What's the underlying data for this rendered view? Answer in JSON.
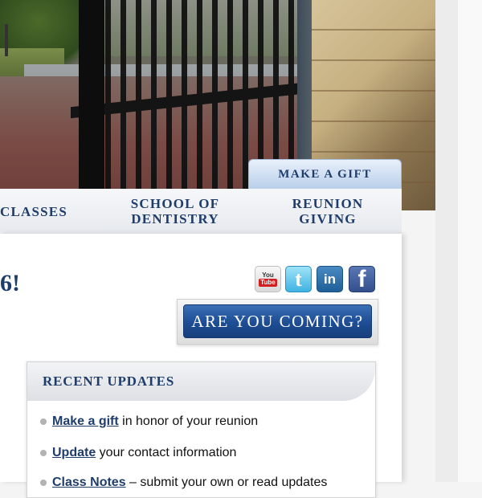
{
  "tab": {
    "make_gift": "MAKE A GIFT"
  },
  "nav": {
    "classes": "CLASSES",
    "dentistry_line1": "SCHOOL OF",
    "dentistry_line2": "DENTISTRY",
    "reunion_line1": "REUNION",
    "reunion_line2": "GIVING"
  },
  "headline_fragment": "6!",
  "social": {
    "youtube_you": "You",
    "youtube_tube": "Tube",
    "twitter_glyph": "t",
    "linkedin_glyph": "in",
    "facebook_glyph": "f",
    "icons": [
      "youtube-icon",
      "twitter-icon",
      "linkedin-icon",
      "facebook-icon"
    ]
  },
  "cta": {
    "label": "ARE YOU COMING?"
  },
  "recent_updates": {
    "title": "RECENT UPDATES",
    "items": [
      {
        "link": "Make a gift",
        "text": " in honor of your reunion"
      },
      {
        "link": "Update",
        "text": " your contact information"
      },
      {
        "link": "Class Notes",
        "text": " – submit your own or read updates"
      }
    ]
  },
  "colors": {
    "brand_navy": "#1f3d6b",
    "button_blue": "#1d4d94",
    "tab_blue": "#b9cfea"
  }
}
